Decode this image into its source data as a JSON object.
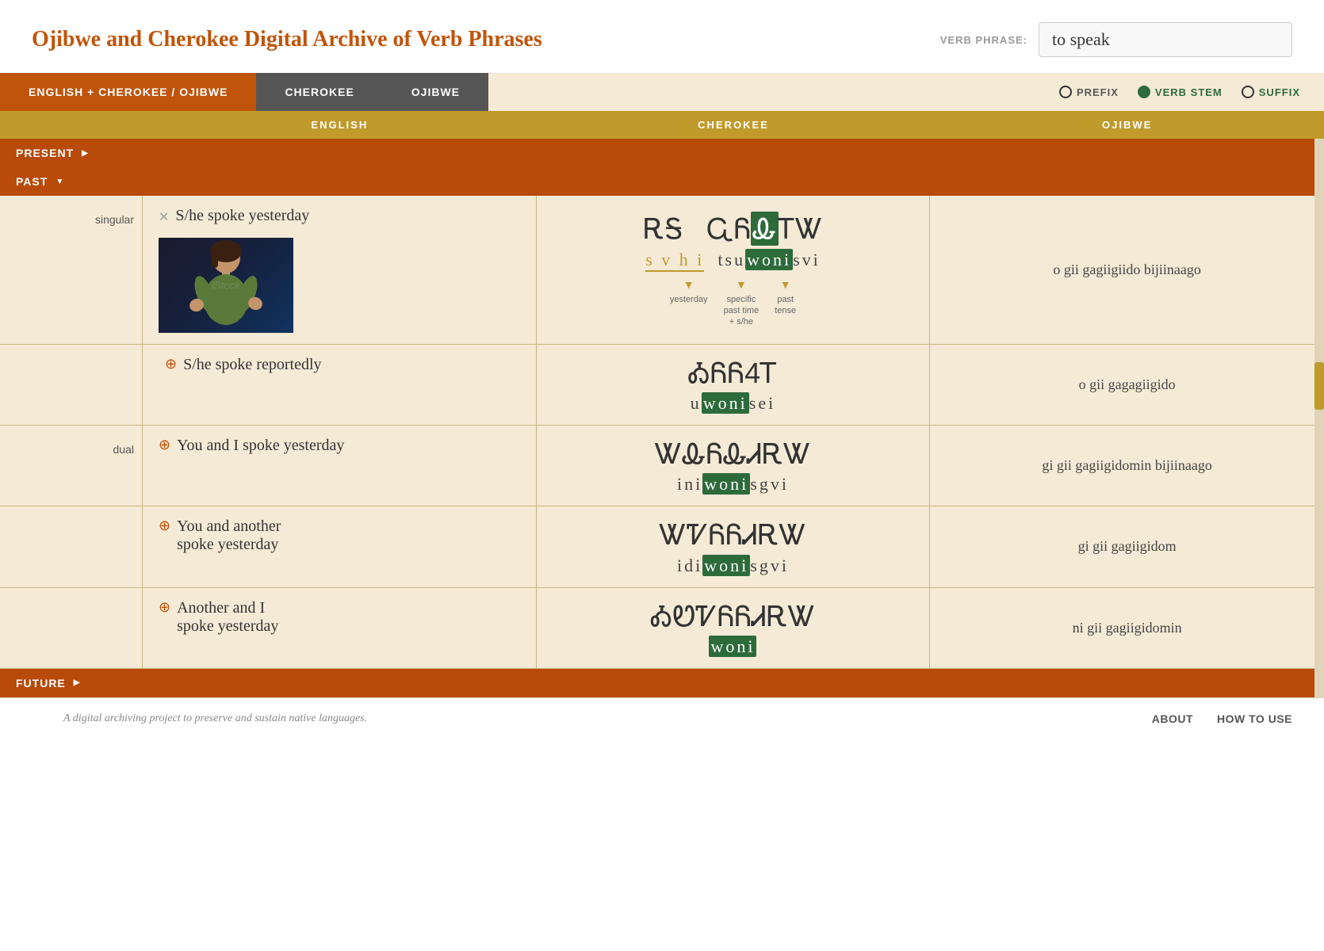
{
  "header": {
    "title": "Ojibwe and Cherokee Digital Archive of Verb Phrases",
    "verb_phrase_label": "VERB PHRASE:",
    "verb_phrase_value": "to speak"
  },
  "tabs": {
    "tab1": "ENGLISH + CHEROKEE / OJIBWE",
    "tab2": "CHEROKEE",
    "tab3": "OJIBWE"
  },
  "legend": {
    "prefix_label": "PREFIX",
    "stem_label": "VERB STEM",
    "suffix_label": "SUFFIX"
  },
  "col_headers": {
    "col1": "ENGLISH",
    "col2": "CHEROKEE",
    "col3": "OJIBWE"
  },
  "sections": {
    "present": "PRESENT",
    "past": "PAST",
    "future": "FUTURE"
  },
  "rows": [
    {
      "label": "singular",
      "english": "S/he spoke yesterday",
      "has_image": true,
      "expanded": true,
      "cherokee_syllabary": "ᎡᎦ  ᏩᏲᎲᎢᏔ",
      "cherokee_latin_parts": [
        {
          "text": "s v h i",
          "type": "prefix"
        },
        {
          "text": " tsu",
          "type": "plain"
        },
        {
          "text": "woni",
          "type": "stem"
        },
        {
          "text": "svi",
          "type": "plain"
        }
      ],
      "cherokee_labels": [
        {
          "text": "yesterday",
          "pos": 0
        },
        {
          "text": "specific\npast time\n+ s/he",
          "pos": 1
        },
        {
          "text": "past\ntense",
          "pos": 2
        }
      ],
      "ojibwe": "o gii gagiigiido bijiinaago"
    },
    {
      "label": "",
      "english": "S/he spoke reportedly",
      "has_image": false,
      "expanded": false,
      "cherokee_syllabary": "ᎣᏲᏲ4Ꭲ",
      "cherokee_latin_parts": [
        {
          "text": "u",
          "type": "plain"
        },
        {
          "text": "woni",
          "type": "stem"
        },
        {
          "text": "sei",
          "type": "plain"
        }
      ],
      "cherokee_labels": [],
      "ojibwe": "o gii gagagiigido"
    },
    {
      "label": "dual",
      "english": "You and I spoke yesterday",
      "has_image": false,
      "expanded": false,
      "cherokee_syllabary": "ᏔᎲᏲᎲᏗᎡᏔ",
      "cherokee_latin_parts": [
        {
          "text": "ini",
          "type": "plain"
        },
        {
          "text": "woni",
          "type": "stem"
        },
        {
          "text": "sgvi",
          "type": "plain"
        }
      ],
      "cherokee_labels": [],
      "ojibwe": "gi gii gagiigidomin bijiinaago"
    },
    {
      "label": "",
      "english": "You and another\nspoke yesterday",
      "has_image": false,
      "expanded": false,
      "cherokee_syllabary": "ᏔᏤᏲᏲᏗᎡᏔ",
      "cherokee_latin_parts": [
        {
          "text": "idi",
          "type": "plain"
        },
        {
          "text": "woni",
          "type": "stem"
        },
        {
          "text": "sgvi",
          "type": "plain"
        }
      ],
      "cherokee_labels": [],
      "ojibwe": "gi gii gagiigidom"
    },
    {
      "label": "",
      "english": "Another and I\nspoke yesterday",
      "has_image": false,
      "expanded": false,
      "cherokee_syllabary": "ᎣᏬᏤᏲᏲᏗᎡᏔ",
      "cherokee_latin_parts": [
        {
          "text": "",
          "type": "plain"
        },
        {
          "text": "woni",
          "type": "stem"
        },
        {
          "text": "",
          "type": "plain"
        }
      ],
      "cherokee_labels": [],
      "ojibwe": "ni gii gagiigidomin"
    }
  ],
  "footer": {
    "tagline": "A digital archiving project to preserve and sustain native languages.",
    "about": "ABOUT",
    "how_to_use": "HOW TO USE"
  }
}
